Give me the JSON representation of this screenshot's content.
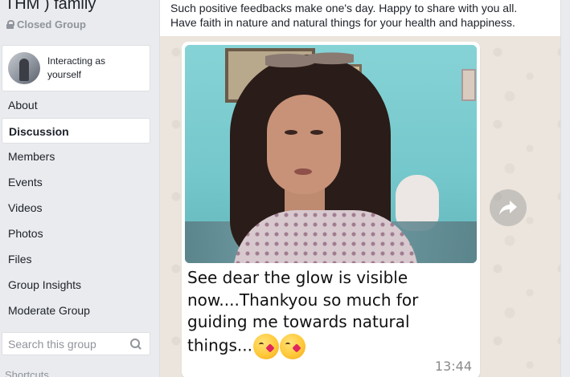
{
  "group": {
    "title": "THM ) family",
    "privacy": "Closed Group"
  },
  "identity": {
    "label": "Interacting as yourself"
  },
  "nav": {
    "items": [
      {
        "label": "About"
      },
      {
        "label": "Discussion"
      },
      {
        "label": "Members"
      },
      {
        "label": "Events"
      },
      {
        "label": "Videos"
      },
      {
        "label": "Photos"
      },
      {
        "label": "Files"
      },
      {
        "label": "Group Insights"
      },
      {
        "label": "Moderate Group"
      }
    ],
    "active": "Discussion"
  },
  "search": {
    "placeholder": "Search this group"
  },
  "shortcuts": {
    "label": "Shortcuts"
  },
  "post": {
    "text": "Such positive feedbacks make one's day. Happy to share with you all. Have faith in nature and natural things for your health and happiness.",
    "message": {
      "text": "See dear the glow is visible now....Thankyou so much for guiding me towards natural things...",
      "emoji_count": 2,
      "time": "13:44"
    }
  },
  "icons": {
    "privacy": "lock-icon",
    "search": "search-icon",
    "share": "share-icon"
  }
}
